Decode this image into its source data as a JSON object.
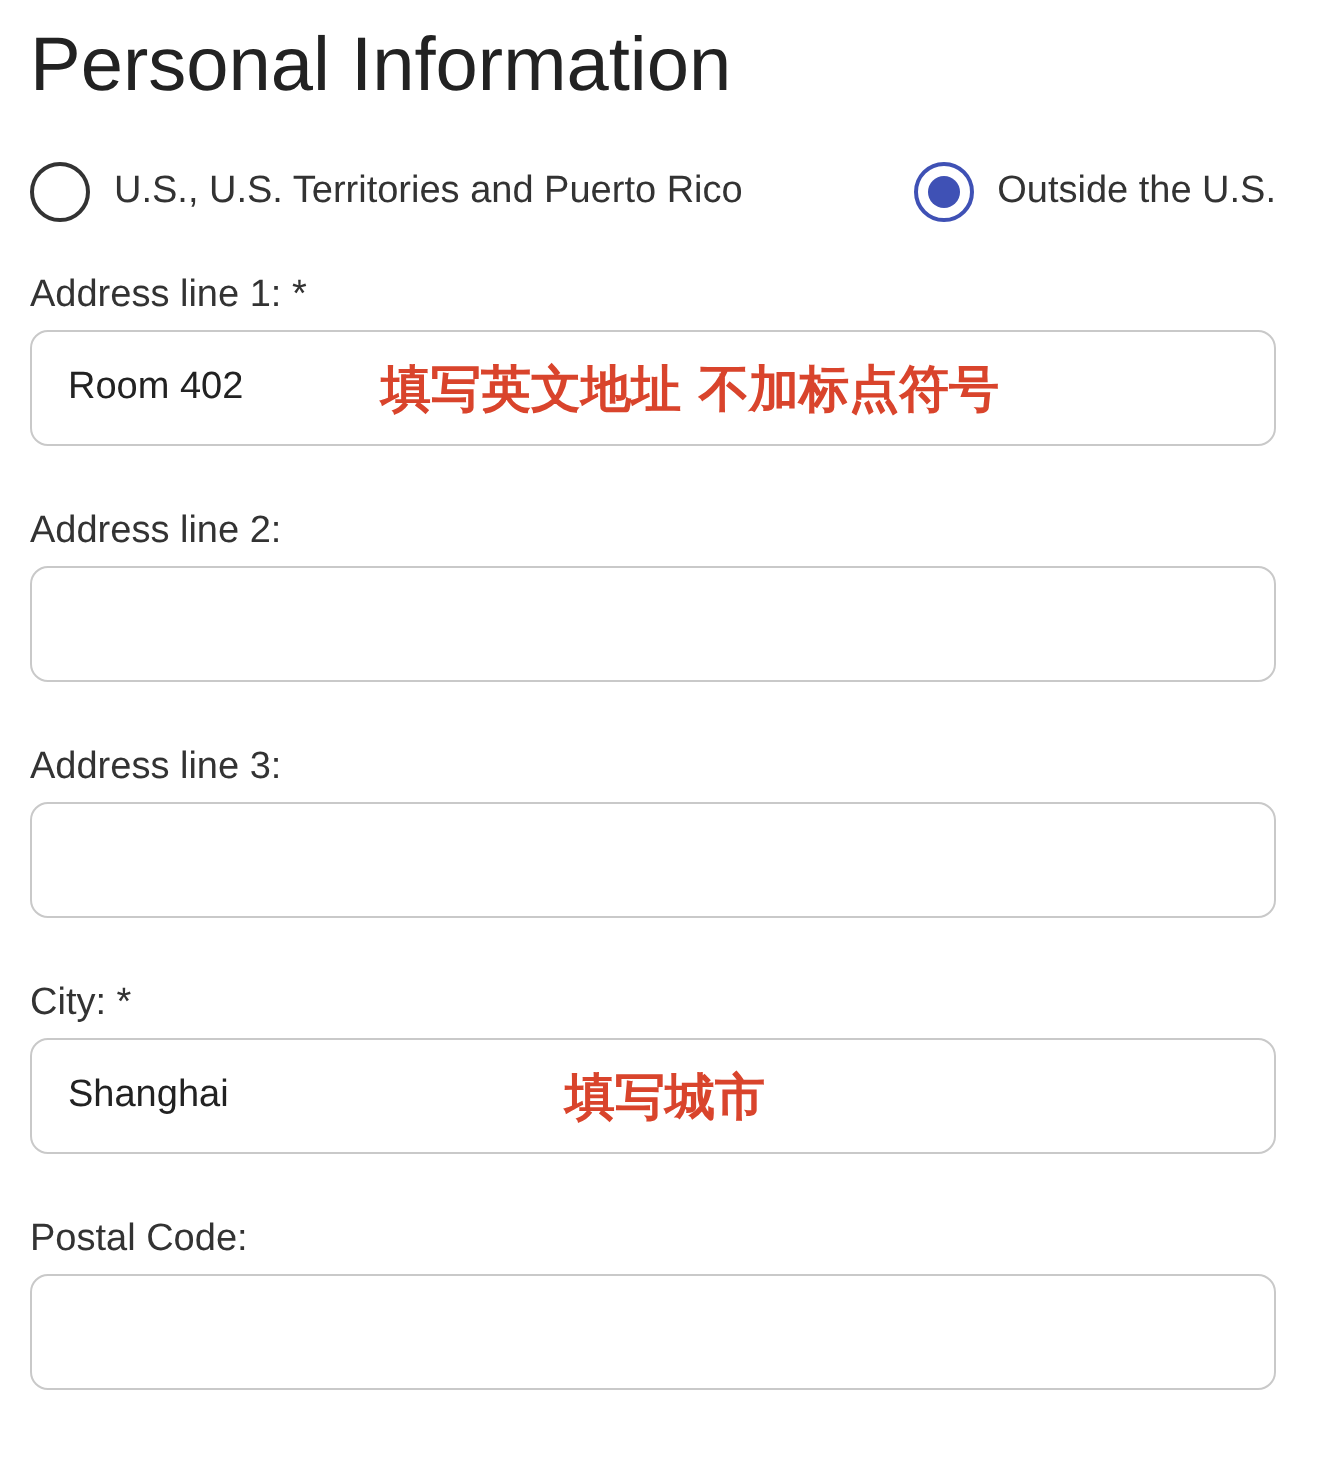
{
  "title": "Personal Information",
  "location_options": [
    {
      "label": "U.S., U.S. Territories and Puerto Rico",
      "selected": false
    },
    {
      "label": "Outside the U.S.",
      "selected": true
    }
  ],
  "fields": [
    {
      "label": "Address line 1: *",
      "value": "Room 402",
      "annotation": "填写英文地址 不加标点符号"
    },
    {
      "label": "Address line 2:"
    },
    {
      "label": "Address line 3:"
    },
    {
      "label": "City: *",
      "value": "Shanghai",
      "annotation": "填写城市"
    },
    {
      "label": "Postal Code:"
    }
  ]
}
